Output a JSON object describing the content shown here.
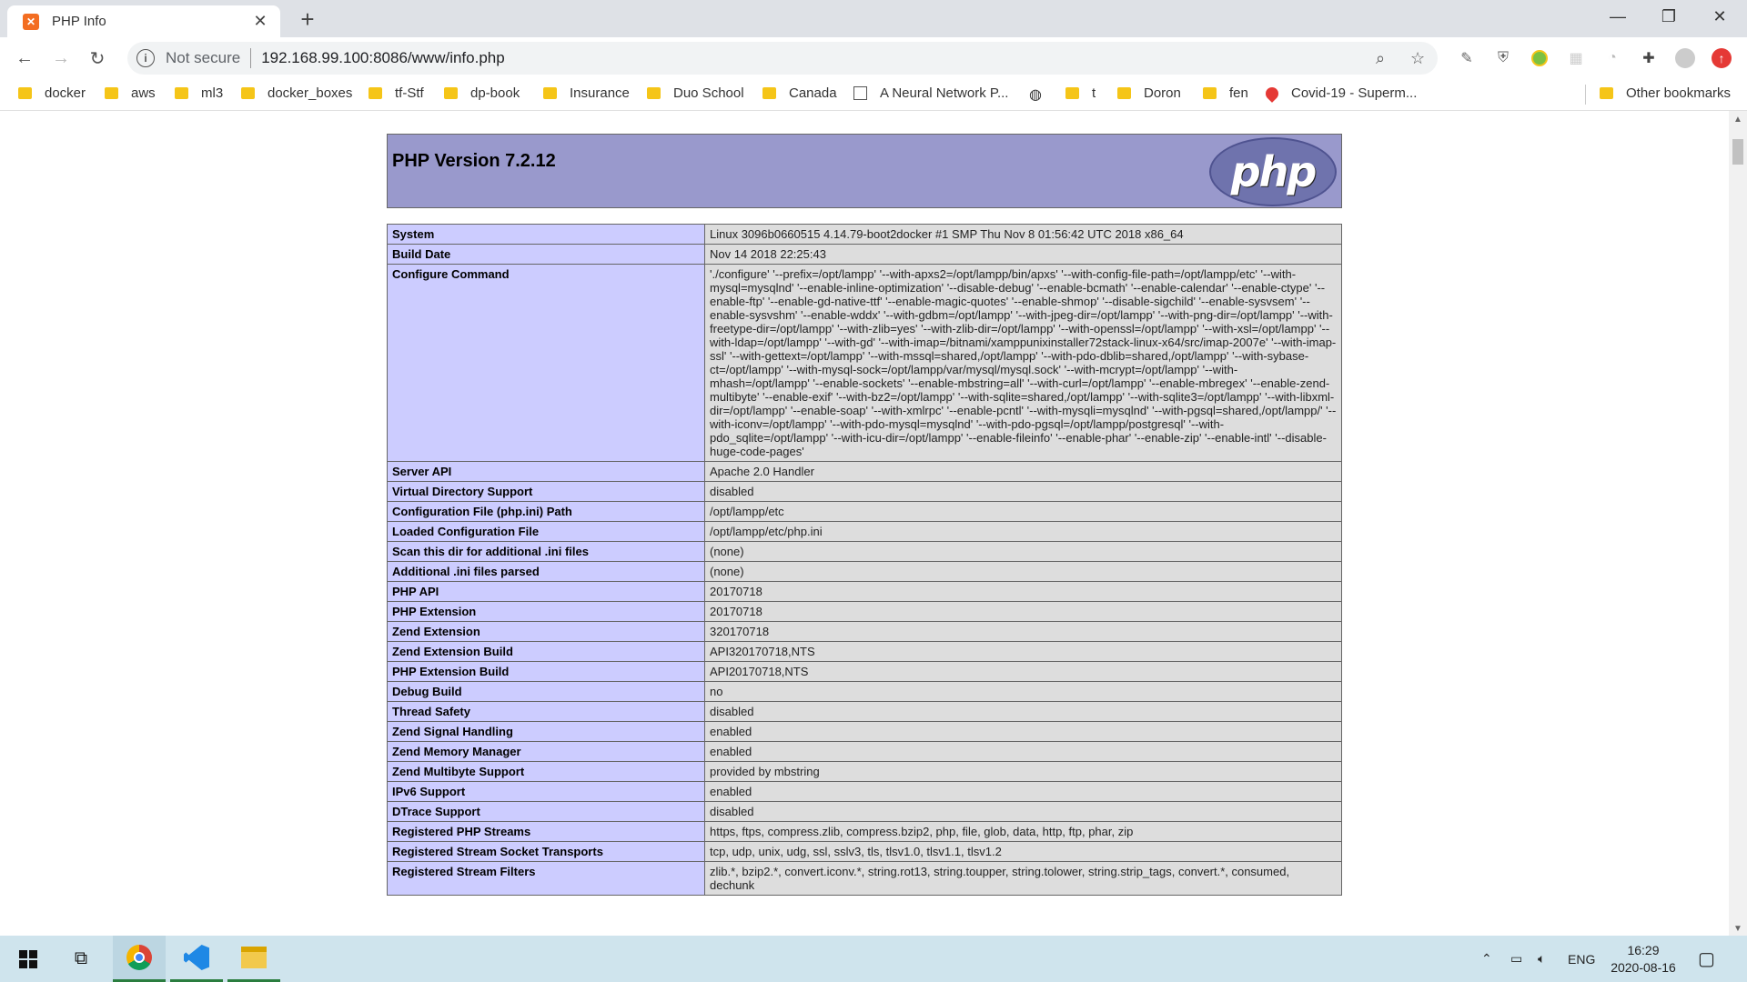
{
  "browser": {
    "tab_title": "PHP Info",
    "tab_favicon": "xampp-icon",
    "new_tab_icon": "+",
    "security_label": "Not secure",
    "url_host": "192.168.99.100",
    "url_rest": ":8086/www/info.php",
    "bookmarks": [
      {
        "label": "docker",
        "icon": "folder-icon"
      },
      {
        "label": "aws",
        "icon": "folder-icon"
      },
      {
        "label": "ml3",
        "icon": "folder-icon"
      },
      {
        "label": "docker_boxes",
        "icon": "folder-icon"
      },
      {
        "label": "tf-Stf",
        "icon": "folder-icon"
      },
      {
        "label": "dp-book",
        "icon": "folder-icon"
      },
      {
        "label": "Insurance",
        "icon": "folder-icon"
      },
      {
        "label": "Duo School",
        "icon": "folder-icon"
      },
      {
        "label": "Canada",
        "icon": "folder-icon"
      },
      {
        "label": "A Neural Network P...",
        "icon": "page-icon"
      },
      {
        "label": "",
        "icon": "globe-icon"
      },
      {
        "label": "t",
        "icon": "folder-icon"
      },
      {
        "label": "Doron",
        "icon": "folder-icon"
      },
      {
        "label": "fen",
        "icon": "folder-icon"
      },
      {
        "label": "Covid-19 - Superm...",
        "icon": "map-pin-icon"
      }
    ],
    "other_bookmarks": "Other bookmarks"
  },
  "phpinfo": {
    "title": "PHP Version 7.2.12",
    "logo_text": "php",
    "rows": [
      {
        "key": "System",
        "value": "Linux 3096b0660515 4.14.79-boot2docker #1 SMP Thu Nov 8 01:56:42 UTC 2018 x86_64"
      },
      {
        "key": "Build Date",
        "value": "Nov 14 2018 22:25:43"
      },
      {
        "key": "Configure Command",
        "value": "'./configure' '--prefix=/opt/lampp' '--with-apxs2=/opt/lampp/bin/apxs' '--with-config-file-path=/opt/lampp/etc' '--with-mysql=mysqlnd' '--enable-inline-optimization' '--disable-debug' '--enable-bcmath' '--enable-calendar' '--enable-ctype' '--enable-ftp' '--enable-gd-native-ttf' '--enable-magic-quotes' '--enable-shmop' '--disable-sigchild' '--enable-sysvsem' '--enable-sysvshm' '--enable-wddx' '--with-gdbm=/opt/lampp' '--with-jpeg-dir=/opt/lampp' '--with-png-dir=/opt/lampp' '--with-freetype-dir=/opt/lampp' '--with-zlib=yes' '--with-zlib-dir=/opt/lampp' '--with-openssl=/opt/lampp' '--with-xsl=/opt/lampp' '--with-ldap=/opt/lampp' '--with-gd' '--with-imap=/bitnami/xamppunixinstaller72stack-linux-x64/src/imap-2007e' '--with-imap-ssl' '--with-gettext=/opt/lampp' '--with-mssql=shared,/opt/lampp' '--with-pdo-dblib=shared,/opt/lampp' '--with-sybase-ct=/opt/lampp' '--with-mysql-sock=/opt/lampp/var/mysql/mysql.sock' '--with-mcrypt=/opt/lampp' '--with-mhash=/opt/lampp' '--enable-sockets' '--enable-mbstring=all' '--with-curl=/opt/lampp' '--enable-mbregex' '--enable-zend-multibyte' '--enable-exif' '--with-bz2=/opt/lampp' '--with-sqlite=shared,/opt/lampp' '--with-sqlite3=/opt/lampp' '--with-libxml-dir=/opt/lampp' '--enable-soap' '--with-xmlrpc' '--enable-pcntl' '--with-mysqli=mysqlnd' '--with-pgsql=shared,/opt/lampp/' '--with-iconv=/opt/lampp' '--with-pdo-mysql=mysqlnd' '--with-pdo-pgsql=/opt/lampp/postgresql' '--with-pdo_sqlite=/opt/lampp' '--with-icu-dir=/opt/lampp' '--enable-fileinfo' '--enable-phar' '--enable-zip' '--enable-intl' '--disable-huge-code-pages'"
      },
      {
        "key": "Server API",
        "value": "Apache 2.0 Handler"
      },
      {
        "key": "Virtual Directory Support",
        "value": "disabled"
      },
      {
        "key": "Configuration File (php.ini) Path",
        "value": "/opt/lampp/etc"
      },
      {
        "key": "Loaded Configuration File",
        "value": "/opt/lampp/etc/php.ini"
      },
      {
        "key": "Scan this dir for additional .ini files",
        "value": "(none)"
      },
      {
        "key": "Additional .ini files parsed",
        "value": "(none)"
      },
      {
        "key": "PHP API",
        "value": "20170718"
      },
      {
        "key": "PHP Extension",
        "value": "20170718"
      },
      {
        "key": "Zend Extension",
        "value": "320170718"
      },
      {
        "key": "Zend Extension Build",
        "value": "API320170718,NTS"
      },
      {
        "key": "PHP Extension Build",
        "value": "API20170718,NTS"
      },
      {
        "key": "Debug Build",
        "value": "no"
      },
      {
        "key": "Thread Safety",
        "value": "disabled"
      },
      {
        "key": "Zend Signal Handling",
        "value": "enabled"
      },
      {
        "key": "Zend Memory Manager",
        "value": "enabled"
      },
      {
        "key": "Zend Multibyte Support",
        "value": "provided by mbstring"
      },
      {
        "key": "IPv6 Support",
        "value": "enabled"
      },
      {
        "key": "DTrace Support",
        "value": "disabled"
      },
      {
        "key": "Registered PHP Streams",
        "value": "https, ftps, compress.zlib, compress.bzip2, php, file, glob, data, http, ftp, phar, zip"
      },
      {
        "key": "Registered Stream Socket Transports",
        "value": "tcp, udp, unix, udg, ssl, sslv3, tls, tlsv1.0, tlsv1.1, tlsv1.2"
      },
      {
        "key": "Registered Stream Filters",
        "value": "zlib.*, bzip2.*, convert.iconv.*, string.rot13, string.toupper, string.tolower, string.strip_tags, convert.*, consumed, dechunk"
      }
    ]
  },
  "taskbar": {
    "language": "ENG",
    "time": "16:29",
    "date": "2020-08-16"
  },
  "colors": {
    "php_header": "#9999cc",
    "key_cell": "#ccccff",
    "value_cell": "#dddddd",
    "taskbar": "#cfe4ed"
  }
}
